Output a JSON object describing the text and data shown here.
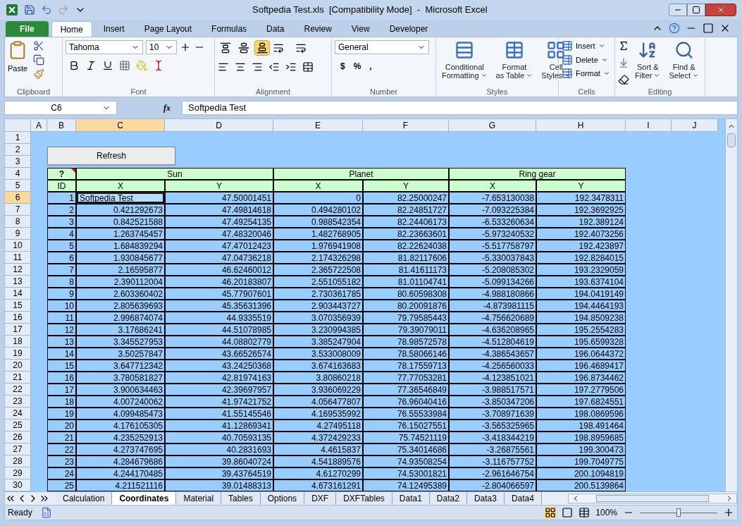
{
  "window": {
    "title": "Softpedia Test.xls  [Compatibility Mode]  -  Microsoft Excel"
  },
  "file_tab": "File",
  "ribbon_tabs": [
    {
      "label": "Home",
      "selected": true
    },
    {
      "label": "Insert",
      "selected": false
    },
    {
      "label": "Page Layout",
      "selected": false
    },
    {
      "label": "Formulas",
      "selected": false
    },
    {
      "label": "Data",
      "selected": false
    },
    {
      "label": "Review",
      "selected": false
    },
    {
      "label": "View",
      "selected": false
    },
    {
      "label": "Developer",
      "selected": false
    }
  ],
  "clipboard": {
    "label": "Clipboard",
    "paste": "Paste"
  },
  "font": {
    "label": "Font",
    "name": "Tahoma",
    "size": "10"
  },
  "alignment": {
    "label": "Alignment",
    "vertical": [
      {
        "selected": false
      },
      {
        "selected": false
      },
      {
        "selected": true
      }
    ]
  },
  "number": {
    "label": "Number",
    "format": "General",
    "currency": "$",
    "percent": "%",
    "comma": ","
  },
  "styles": {
    "label": "Styles",
    "buttons": [
      [
        "Conditional",
        "Formatting"
      ],
      [
        "Format",
        "as Table"
      ],
      [
        "Cell",
        "Styles"
      ]
    ]
  },
  "cells": {
    "label": "Cells",
    "buttons": [
      "Insert",
      "Delete",
      "Format"
    ]
  },
  "editing": {
    "label": "Editing",
    "buttons": [
      [
        "Sort &",
        "Filter"
      ],
      [
        "Find &",
        "Select"
      ]
    ]
  },
  "formula_bar": {
    "name_box": "C6",
    "fx": "fx",
    "value": "Softpedia Test"
  },
  "columns": [
    {
      "label": "A",
      "selected": false
    },
    {
      "label": "B",
      "selected": false
    },
    {
      "label": "C",
      "selected": true
    },
    {
      "label": "D",
      "selected": false
    },
    {
      "label": "E",
      "selected": false
    },
    {
      "label": "F",
      "selected": false
    },
    {
      "label": "G",
      "selected": false
    },
    {
      "label": "H",
      "selected": false
    },
    {
      "label": "I",
      "selected": false
    },
    {
      "label": "J",
      "selected": false
    }
  ],
  "row_numbers": [
    {
      "label": "1",
      "selected": false
    },
    {
      "label": "2",
      "selected": false
    },
    {
      "label": "3",
      "selected": false
    },
    {
      "label": "4",
      "selected": false
    },
    {
      "label": "5",
      "selected": false
    },
    {
      "label": "6",
      "selected": true
    },
    {
      "label": "7",
      "selected": false
    },
    {
      "label": "8",
      "selected": false
    },
    {
      "label": "9",
      "selected": false
    },
    {
      "label": "10",
      "selected": false
    },
    {
      "label": "11",
      "selected": false
    },
    {
      "label": "12",
      "selected": false
    },
    {
      "label": "13",
      "selected": false
    },
    {
      "label": "14",
      "selected": false
    },
    {
      "label": "15",
      "selected": false
    },
    {
      "label": "16",
      "selected": false
    },
    {
      "label": "17",
      "selected": false
    },
    {
      "label": "18",
      "selected": false
    },
    {
      "label": "19",
      "selected": false
    },
    {
      "label": "20",
      "selected": false
    },
    {
      "label": "21",
      "selected": false
    },
    {
      "label": "22",
      "selected": false
    },
    {
      "label": "23",
      "selected": false
    },
    {
      "label": "24",
      "selected": false
    },
    {
      "label": "25",
      "selected": false
    },
    {
      "label": "26",
      "selected": false
    },
    {
      "label": "27",
      "selected": false
    },
    {
      "label": "28",
      "selected": false
    },
    {
      "label": "29",
      "selected": false
    },
    {
      "label": "30",
      "selected": false
    }
  ],
  "refresh_button": "Refresh",
  "table": {
    "corner": "?",
    "groups": [
      "Sun",
      "Planet",
      "Ring gear"
    ],
    "subheaders": [
      "ID",
      "X",
      "Y",
      "X",
      "Y",
      "X",
      "Y"
    ],
    "rows": [
      {
        "selected": true,
        "cells": [
          "1",
          "Softpedia Test",
          "47.50001451",
          "0",
          "82.25000247",
          "-7.653130038",
          "192.3478311"
        ]
      },
      {
        "selected": false,
        "cells": [
          "2",
          "0.421292673",
          "47.49814618",
          "0.494280102",
          "82.24851727",
          "-7.093225384",
          "192.3692925"
        ]
      },
      {
        "selected": false,
        "cells": [
          "3",
          "0.842521588",
          "47.49254135",
          "0.988542354",
          "82.24406173",
          "-6.533260634",
          "192.389124"
        ]
      },
      {
        "selected": false,
        "cells": [
          "4",
          "1.263745457",
          "47.48320046",
          "1.482768905",
          "82.23663601",
          "-5.973240532",
          "192.4073256"
        ]
      },
      {
        "selected": false,
        "cells": [
          "5",
          "1.684839294",
          "47.47012423",
          "1.976941908",
          "82.22624038",
          "-5.517758797",
          "192.423897"
        ]
      },
      {
        "selected": false,
        "cells": [
          "6",
          "1.930845677",
          "47.04736218",
          "2.174326298",
          "81.82117606",
          "-5.330037843",
          "192.8284015"
        ]
      },
      {
        "selected": false,
        "cells": [
          "7",
          "2.16595877",
          "46.62460012",
          "2.365722508",
          "81.41611173",
          "-5.208085302",
          "193.2329059"
        ]
      },
      {
        "selected": false,
        "cells": [
          "8",
          "2.390112004",
          "46.20183807",
          "2.551055182",
          "81.01104741",
          "-5.099134266",
          "193.6374104"
        ]
      },
      {
        "selected": false,
        "cells": [
          "9",
          "2.603360402",
          "45.77907601",
          "2.730361785",
          "80.60598308",
          "-4.988180866",
          "194.0419149"
        ]
      },
      {
        "selected": false,
        "cells": [
          "10",
          "2.805639693",
          "45.35631396",
          "2.903443727",
          "80.20091876",
          "-4.873981115",
          "194.4464193"
        ]
      },
      {
        "selected": false,
        "cells": [
          "11",
          "2.996874074",
          "44.9335519",
          "3.070356939",
          "79.79585443",
          "-4.756620689",
          "194.8509238"
        ]
      },
      {
        "selected": false,
        "cells": [
          "12",
          "3.17686241",
          "44.51078985",
          "3.230994385",
          "79.39079011",
          "-4.636208965",
          "195.2554283"
        ]
      },
      {
        "selected": false,
        "cells": [
          "13",
          "3.345527953",
          "44.08802779",
          "3.385247904",
          "78.98572578",
          "-4.512804619",
          "195.6599328"
        ]
      },
      {
        "selected": false,
        "cells": [
          "14",
          "3.50257847",
          "43.66526574",
          "3.533008009",
          "78.58066146",
          "-4.386543657",
          "196.0644372"
        ]
      },
      {
        "selected": false,
        "cells": [
          "15",
          "3.647712342",
          "43.24250368",
          "3.674163683",
          "78.17559713",
          "-4.256560033",
          "196.4689417"
        ]
      },
      {
        "selected": false,
        "cells": [
          "16",
          "3.780581827",
          "42.81974163",
          "3.80860218",
          "77.77053281",
          "-4.123851021",
          "196.8734462"
        ]
      },
      {
        "selected": false,
        "cells": [
          "17",
          "3.900634463",
          "42.39697957",
          "3.936069229",
          "77.36546849",
          "-3.988517571",
          "197.2779506"
        ]
      },
      {
        "selected": false,
        "cells": [
          "18",
          "4.007240062",
          "41.97421752",
          "4.056477807",
          "76.96040416",
          "-3.850347206",
          "197.6824551"
        ]
      },
      {
        "selected": false,
        "cells": [
          "19",
          "4.099485473",
          "41.55145546",
          "4.169535992",
          "76.55533984",
          "-3.708971639",
          "198.0869596"
        ]
      },
      {
        "selected": false,
        "cells": [
          "20",
          "4.176105305",
          "41.12869341",
          "4.27495118",
          "76.15027551",
          "-3.565325965",
          "198.491464"
        ]
      },
      {
        "selected": false,
        "cells": [
          "21",
          "4.235252913",
          "40.70593135",
          "4.372429233",
          "75.74521119",
          "-3.418344219",
          "198.8959685"
        ]
      },
      {
        "selected": false,
        "cells": [
          "22",
          "4.273747695",
          "40.2831693",
          "4.4615837",
          "75.34014686",
          "-3.26875561",
          "199.300473"
        ]
      },
      {
        "selected": false,
        "cells": [
          "23",
          "4.284679686",
          "39.86040724",
          "4.541889576",
          "74.93508254",
          "-3.116757752",
          "199.7049775"
        ]
      },
      {
        "selected": false,
        "cells": [
          "24",
          "4.244170485",
          "39.43764519",
          "4.61270299",
          "74.53001821",
          "-2.961646754",
          "200.1094819"
        ]
      },
      {
        "selected": false,
        "cells": [
          "25",
          "4.211521116",
          "39.01488313",
          "4.673161291",
          "74.12495389",
          "-2.804066597",
          "200.5139864"
        ]
      }
    ]
  },
  "sheet_tabs": [
    {
      "label": "Calculation",
      "selected": false
    },
    {
      "label": "Coordinates",
      "selected": true
    },
    {
      "label": "Material",
      "selected": false
    },
    {
      "label": "Tables",
      "selected": false
    },
    {
      "label": "Options",
      "selected": false
    },
    {
      "label": "DXF",
      "selected": false
    },
    {
      "label": "DXFTables",
      "selected": false
    },
    {
      "label": "Data1",
      "selected": false
    },
    {
      "label": "Data2",
      "selected": false
    },
    {
      "label": "Data3",
      "selected": false
    },
    {
      "label": "Data4",
      "selected": false
    }
  ],
  "status_bar": {
    "status": "Ready",
    "zoom": "100%",
    "zoom_slider": {
      "level": 0.5
    }
  }
}
